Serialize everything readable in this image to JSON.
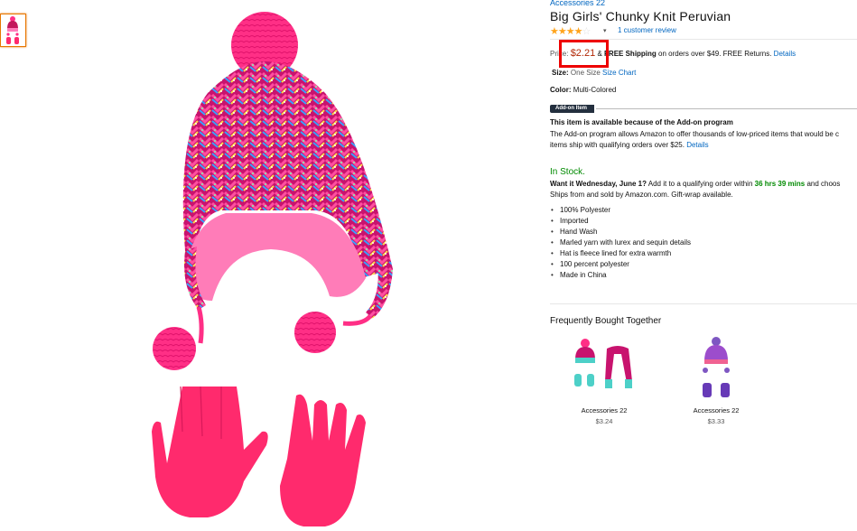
{
  "product": {
    "brand": "Accessories 22",
    "title": "Big Girls' Chunky Knit Peruvian",
    "rating_stars": "★★★★",
    "rating_empty": "☆",
    "review_link": "1 customer review",
    "price_label": "Price:",
    "price": "$2.21",
    "amp": "&",
    "free_bold": "FREE Shipping",
    "shipping_text": "on orders over $49. FREE Returns.",
    "shipping_details": "Details",
    "size_label": "Size:",
    "size_value": "One Size",
    "size_chart": "Size Chart",
    "color_label": "Color:",
    "color_value": "Multi-Colored"
  },
  "addon": {
    "badge": "Add-on Item",
    "title": "This item is available because of the Add-on program",
    "text_1": "The Add-on program allows Amazon to offer thousands of low-priced items that would be c",
    "text_2": "items ship with qualifying orders over $25.",
    "details": "Details"
  },
  "availability": {
    "status": "In Stock.",
    "want_it": "Want it Wednesday, June 1?",
    "add_text": "Add it to a qualifying order within",
    "countdown": "36 hrs 39 mins",
    "and_choose": "and choos",
    "ships_from": "Ships from and sold by Amazon.com. Gift-wrap available."
  },
  "features": [
    "100% Polyester",
    "Imported",
    "Hand Wash",
    "Marled yarn with lurex and sequin details",
    "Hat is fleece lined for extra warmth",
    "100 percent polyester",
    "Made in China"
  ],
  "fbt": {
    "title": "Frequently Bought Together",
    "items": [
      {
        "name": "Accessories 22",
        "price": "$3.24"
      },
      {
        "name": "Accessories 22",
        "price": "$3.33"
      }
    ]
  },
  "colors": {
    "hat_pink": "#ff2f86",
    "glove_pink": "#ff2a6d",
    "fleece": "#ff7cb8",
    "price_red": "#b12704",
    "highlight_red": "#ee0000",
    "instock_green": "#008a00",
    "link_blue": "#0066c0"
  }
}
